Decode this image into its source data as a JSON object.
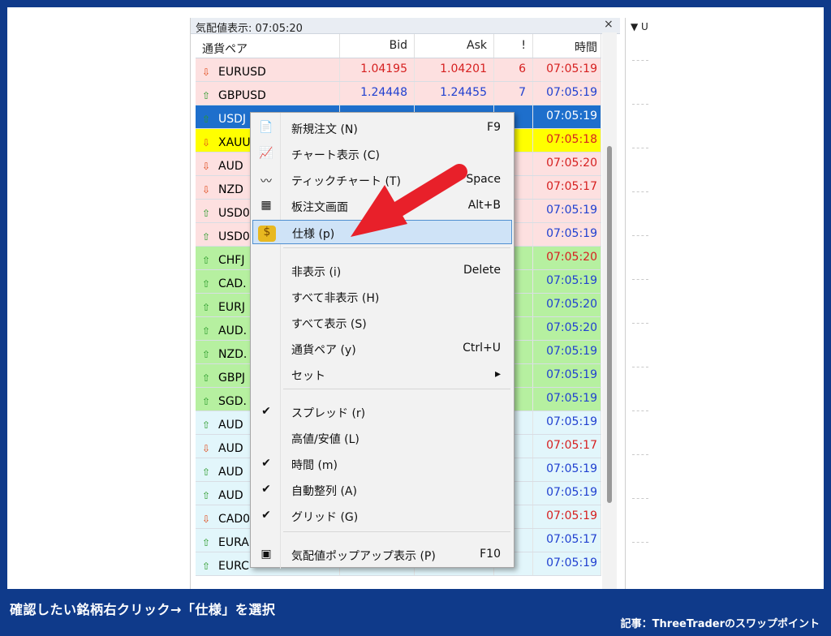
{
  "caption": "確認したい銘柄右クリック→「仕様」を選択",
  "credit": "記事：ThreeTraderのスワップポイント",
  "market_watch": {
    "title": "気配値表示: 07:05:20",
    "close_symbol": "×",
    "columns": [
      "通貨ペア",
      "Bid",
      "Ask",
      "!",
      "時間"
    ],
    "rows": [
      {
        "symbol": "EURUSD",
        "dir": "down",
        "bid": "1.04195",
        "ask": "1.04201",
        "spread": "6",
        "time": "07:05:19",
        "bg": "#fde0e0",
        "color": "#d62020"
      },
      {
        "symbol": "GBPUSD",
        "dir": "up",
        "bid": "1.24448",
        "ask": "1.24455",
        "spread": "7",
        "time": "07:05:19",
        "bg": "#fde0e0",
        "color": "#2040d0"
      },
      {
        "symbol": "USDJ",
        "dir": "up",
        "bid": "",
        "ask": "",
        "spread": "",
        "time": "07:05:19",
        "bg": "#1e6fcc",
        "color": "#ffffff"
      },
      {
        "symbol": "XAUU",
        "dir": "down",
        "bid": "",
        "ask": "",
        "spread": "",
        "time": "07:05:18",
        "bg": "#ffff00",
        "color": "#d62020"
      },
      {
        "symbol": "AUD",
        "dir": "down",
        "bid": "",
        "ask": "",
        "spread": "",
        "time": "07:05:20",
        "bg": "#fde0e0",
        "color": "#d62020"
      },
      {
        "symbol": "NZD",
        "dir": "down",
        "bid": "",
        "ask": "",
        "spread": "",
        "time": "07:05:17",
        "bg": "#fde0e0",
        "color": "#d62020"
      },
      {
        "symbol": "USD0",
        "dir": "up",
        "bid": "",
        "ask": "",
        "spread": "",
        "time": "07:05:19",
        "bg": "#fde0e0",
        "color": "#2040d0"
      },
      {
        "symbol": "USD0",
        "dir": "up",
        "bid": "",
        "ask": "",
        "spread": "",
        "time": "07:05:19",
        "bg": "#fde0e0",
        "color": "#2040d0"
      },
      {
        "symbol": "CHFJ",
        "dir": "up",
        "bid": "",
        "ask": "",
        "spread": "",
        "time": "07:05:20",
        "bg": "#b6f0a0",
        "color": "#d62020"
      },
      {
        "symbol": "CAD.",
        "dir": "up",
        "bid": "",
        "ask": "",
        "spread": "",
        "time": "07:05:19",
        "bg": "#b6f0a0",
        "color": "#2040d0"
      },
      {
        "symbol": "EURJ",
        "dir": "up",
        "bid": "",
        "ask": "",
        "spread": "",
        "time": "07:05:20",
        "bg": "#b6f0a0",
        "color": "#2040d0"
      },
      {
        "symbol": "AUD.",
        "dir": "up",
        "bid": "",
        "ask": "",
        "spread": "",
        "time": "07:05:20",
        "bg": "#b6f0a0",
        "color": "#2040d0"
      },
      {
        "symbol": "NZD.",
        "dir": "up",
        "bid": "",
        "ask": "",
        "spread": "",
        "time": "07:05:19",
        "bg": "#b6f0a0",
        "color": "#2040d0"
      },
      {
        "symbol": "GBPJ",
        "dir": "up",
        "bid": "",
        "ask": "",
        "spread": "",
        "time": "07:05:19",
        "bg": "#b6f0a0",
        "color": "#2040d0"
      },
      {
        "symbol": "SGD.",
        "dir": "up",
        "bid": "",
        "ask": "",
        "spread": "",
        "time": "07:05:19",
        "bg": "#b6f0a0",
        "color": "#2040d0"
      },
      {
        "symbol": "AUD",
        "dir": "up",
        "bid": "",
        "ask": "",
        "spread": "",
        "time": "07:05:19",
        "bg": "#e2f6fb",
        "color": "#2040d0"
      },
      {
        "symbol": "AUD",
        "dir": "down",
        "bid": "",
        "ask": "",
        "spread": "",
        "time": "07:05:17",
        "bg": "#e2f6fb",
        "color": "#d62020"
      },
      {
        "symbol": "AUD",
        "dir": "up",
        "bid": "",
        "ask": "",
        "spread": "",
        "time": "07:05:19",
        "bg": "#e2f6fb",
        "color": "#2040d0"
      },
      {
        "symbol": "AUD",
        "dir": "up",
        "bid": "",
        "ask": "",
        "spread": "",
        "time": "07:05:19",
        "bg": "#e2f6fb",
        "color": "#2040d0"
      },
      {
        "symbol": "CAD0",
        "dir": "down",
        "bid": "",
        "ask": "",
        "spread": "",
        "time": "07:05:19",
        "bg": "#e2f6fb",
        "color": "#d62020"
      },
      {
        "symbol": "EURA",
        "dir": "up",
        "bid": "",
        "ask": "",
        "spread": "",
        "time": "07:05:17",
        "bg": "#e2f6fb",
        "color": "#2040d0"
      },
      {
        "symbol": "EURC",
        "dir": "up",
        "bid": "",
        "ask": "",
        "spread": "",
        "time": "07:05:19",
        "bg": "#e2f6fb",
        "color": "#2040d0"
      }
    ]
  },
  "right_pane": {
    "header": "▼ U"
  },
  "context_menu": {
    "items": [
      {
        "label": "新規注文 (N)",
        "shortcut": "F9",
        "icon": "new-order-icon",
        "glyph": "📄"
      },
      {
        "label": "チャート表示 (C)",
        "shortcut": "",
        "icon": "chart-icon",
        "glyph": "📈"
      },
      {
        "label": "ティックチャート (T)",
        "shortcut": "Space",
        "icon": "tick-chart-icon",
        "glyph": "〰"
      },
      {
        "label": "板注文画面",
        "shortcut": "Alt+B",
        "icon": "depth-of-market-icon",
        "glyph": "▦"
      },
      {
        "label": "仕様 (p)",
        "shortcut": "",
        "icon": "specification-icon",
        "glyph": "$"
      },
      {
        "label": "非表示 (i)",
        "shortcut": "Delete",
        "icon": "",
        "glyph": ""
      },
      {
        "label": "すべて非表示 (H)",
        "shortcut": "",
        "icon": "",
        "glyph": ""
      },
      {
        "label": "すべて表示 (S)",
        "shortcut": "",
        "icon": "",
        "glyph": ""
      },
      {
        "label": "通貨ペア (y)",
        "shortcut": "Ctrl+U",
        "icon": "",
        "glyph": ""
      },
      {
        "label": "セット",
        "shortcut": "▸",
        "icon": "",
        "glyph": ""
      },
      {
        "label": "スプレッド (r)",
        "shortcut": "",
        "icon": "checkmark-icon",
        "glyph": "✔"
      },
      {
        "label": "高値/安値 (L)",
        "shortcut": "",
        "icon": "",
        "glyph": ""
      },
      {
        "label": "時間 (m)",
        "shortcut": "",
        "icon": "checkmark-icon",
        "glyph": "✔"
      },
      {
        "label": "自動整列 (A)",
        "shortcut": "",
        "icon": "checkmark-icon",
        "glyph": "✔"
      },
      {
        "label": "グリッド (G)",
        "shortcut": "",
        "icon": "checkmark-icon",
        "glyph": "✔"
      },
      {
        "label": "気配値ポップアップ表示 (P)",
        "shortcut": "F10",
        "icon": "popup-icon",
        "glyph": "▣"
      }
    ],
    "selected_label": "仕様 (p)"
  },
  "colors": {
    "brand": "#0f3a8a",
    "arrow": "#e8202a",
    "selected": "#cfe3f7"
  }
}
